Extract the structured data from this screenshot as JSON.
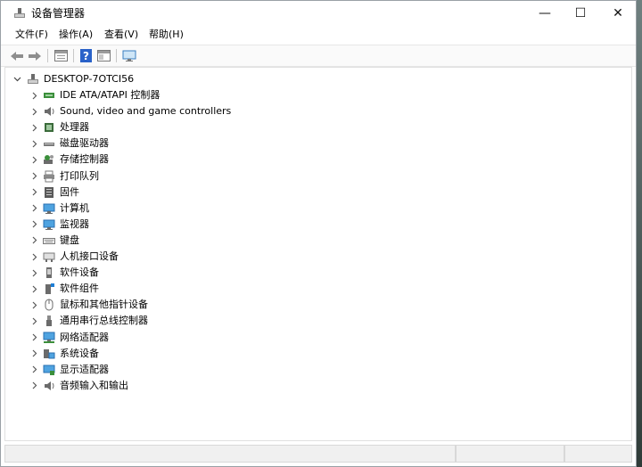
{
  "window": {
    "title": "设备管理器"
  },
  "controls": {
    "minimize": "—",
    "maximize": "☐",
    "close": "✕"
  },
  "menu": [
    {
      "label": "文件(F)"
    },
    {
      "label": "操作(A)"
    },
    {
      "label": "查看(V)"
    },
    {
      "label": "帮助(H)"
    }
  ],
  "tree": {
    "root": {
      "label": "DESKTOP-7OTCI56"
    },
    "items": [
      {
        "label": "IDE ATA/ATAPI 控制器",
        "icon": "ide-controller-icon"
      },
      {
        "label": "Sound, video and game controllers",
        "icon": "speaker-icon"
      },
      {
        "label": "处理器",
        "icon": "processor-icon"
      },
      {
        "label": "磁盘驱动器",
        "icon": "disk-drive-icon"
      },
      {
        "label": "存储控制器",
        "icon": "storage-controller-icon"
      },
      {
        "label": "打印队列",
        "icon": "printer-icon"
      },
      {
        "label": "固件",
        "icon": "firmware-icon"
      },
      {
        "label": "计算机",
        "icon": "computer-icon"
      },
      {
        "label": "监视器",
        "icon": "monitor-icon"
      },
      {
        "label": "键盘",
        "icon": "keyboard-icon"
      },
      {
        "label": "人机接口设备",
        "icon": "hid-icon"
      },
      {
        "label": "软件设备",
        "icon": "software-device-icon"
      },
      {
        "label": "软件组件",
        "icon": "software-component-icon"
      },
      {
        "label": "鼠标和其他指针设备",
        "icon": "mouse-icon"
      },
      {
        "label": "通用串行总线控制器",
        "icon": "usb-icon"
      },
      {
        "label": "网络适配器",
        "icon": "network-adapter-icon"
      },
      {
        "label": "系统设备",
        "icon": "system-device-icon"
      },
      {
        "label": "显示适配器",
        "icon": "display-adapter-icon"
      },
      {
        "label": "音频输入和输出",
        "icon": "audio-io-icon"
      }
    ]
  },
  "colors": {
    "accent_blue": "#1f7fd6",
    "folder_gray": "#6b6b6b",
    "help_blue": "#2a62c9"
  }
}
